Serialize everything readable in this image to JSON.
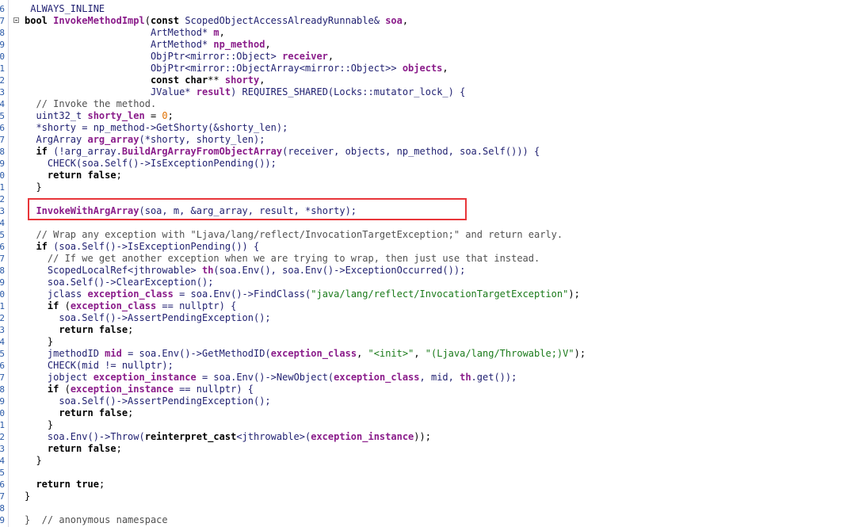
{
  "editor": {
    "lines": [
      {
        "ln": "6",
        "tokens": [
          {
            "t": " ALWAYS_INLINE",
            "c": "mac"
          }
        ]
      },
      {
        "ln": "7",
        "fold": true,
        "tokens": [
          {
            "t": "bool ",
            "c": "kw"
          },
          {
            "t": "InvokeMethodImpl",
            "c": "fn"
          },
          {
            "t": "(",
            "c": "op"
          },
          {
            "t": "const ",
            "c": "kw"
          },
          {
            "t": "ScopedObjectAccessAlreadyRunnable& ",
            "c": "id"
          },
          {
            "t": "soa",
            "c": "var"
          },
          {
            "t": ",",
            "c": "op"
          }
        ]
      },
      {
        "ln": "8",
        "tokens": [
          {
            "t": "                      ArtMethod* ",
            "c": "id"
          },
          {
            "t": "m",
            "c": "var"
          },
          {
            "t": ",",
            "c": "op"
          }
        ]
      },
      {
        "ln": "9",
        "tokens": [
          {
            "t": "                      ArtMethod* ",
            "c": "id"
          },
          {
            "t": "np_method",
            "c": "var"
          },
          {
            "t": ",",
            "c": "op"
          }
        ]
      },
      {
        "ln": "0",
        "tokens": [
          {
            "t": "                      ObjPtr<mirror::Object> ",
            "c": "id"
          },
          {
            "t": "receiver",
            "c": "var"
          },
          {
            "t": ",",
            "c": "op"
          }
        ]
      },
      {
        "ln": "1",
        "tokens": [
          {
            "t": "                      ObjPtr<mirror::ObjectArray<mirror::Object>> ",
            "c": "id"
          },
          {
            "t": "objects",
            "c": "var"
          },
          {
            "t": ",",
            "c": "op"
          }
        ]
      },
      {
        "ln": "2",
        "tokens": [
          {
            "t": "                      ",
            "c": "id"
          },
          {
            "t": "const char",
            "c": "kw"
          },
          {
            "t": "** ",
            "c": "op"
          },
          {
            "t": "shorty",
            "c": "var"
          },
          {
            "t": ",",
            "c": "op"
          }
        ]
      },
      {
        "ln": "3",
        "tokens": [
          {
            "t": "                      JValue* ",
            "c": "id"
          },
          {
            "t": "result",
            "c": "var"
          },
          {
            "t": ") REQUIRES_SHARED(Locks::mutator_lock_) {",
            "c": "id"
          }
        ]
      },
      {
        "ln": "4",
        "tokens": [
          {
            "t": "  // Invoke the method.",
            "c": "cm"
          }
        ]
      },
      {
        "ln": "5",
        "tokens": [
          {
            "t": "  uint32_t ",
            "c": "id"
          },
          {
            "t": "shorty_len",
            "c": "var"
          },
          {
            "t": " = ",
            "c": "op"
          },
          {
            "t": "0",
            "c": "num"
          },
          {
            "t": ";",
            "c": "op"
          }
        ]
      },
      {
        "ln": "6",
        "tokens": [
          {
            "t": "  *shorty = np_method->GetShorty(&shorty_len);",
            "c": "id"
          }
        ]
      },
      {
        "ln": "7",
        "tokens": [
          {
            "t": "  ArgArray ",
            "c": "id"
          },
          {
            "t": "arg_array",
            "c": "var"
          },
          {
            "t": "(*shorty, shorty_len);",
            "c": "id"
          }
        ]
      },
      {
        "ln": "8",
        "tokens": [
          {
            "t": "  ",
            "c": "id"
          },
          {
            "t": "if",
            "c": "kw"
          },
          {
            "t": " (!arg_array.",
            "c": "id"
          },
          {
            "t": "BuildArgArrayFromObjectArray",
            "c": "fn"
          },
          {
            "t": "(receiver, objects, np_method, soa.Self())) {",
            "c": "id"
          }
        ]
      },
      {
        "ln": "9",
        "tokens": [
          {
            "t": "    CHECK(soa.Self()->IsExceptionPending());",
            "c": "id"
          }
        ]
      },
      {
        "ln": "0",
        "tokens": [
          {
            "t": "    ",
            "c": "id"
          },
          {
            "t": "return false",
            "c": "kw"
          },
          {
            "t": ";",
            "c": "op"
          }
        ]
      },
      {
        "ln": "1",
        "tokens": [
          {
            "t": "  }",
            "c": "op"
          }
        ]
      },
      {
        "ln": "2",
        "tokens": []
      },
      {
        "ln": "3",
        "tokens": [
          {
            "t": "  ",
            "c": "id"
          },
          {
            "t": "InvokeWithArgArray",
            "c": "fn"
          },
          {
            "t": "(soa, m, &arg_array, result, *shorty);",
            "c": "id"
          }
        ]
      },
      {
        "ln": "4",
        "tokens": []
      },
      {
        "ln": "5",
        "tokens": [
          {
            "t": "  // Wrap any exception with \"Ljava/lang/reflect/InvocationTargetException;\" and return early.",
            "c": "cm"
          }
        ]
      },
      {
        "ln": "6",
        "tokens": [
          {
            "t": "  ",
            "c": "id"
          },
          {
            "t": "if",
            "c": "kw"
          },
          {
            "t": " (soa.Self()->IsExceptionPending()) {",
            "c": "id"
          }
        ]
      },
      {
        "ln": "7",
        "tokens": [
          {
            "t": "    // If we get another exception when we are trying to wrap, then just use that instead.",
            "c": "cm"
          }
        ]
      },
      {
        "ln": "8",
        "tokens": [
          {
            "t": "    ScopedLocalRef<jthrowable> ",
            "c": "id"
          },
          {
            "t": "th",
            "c": "var"
          },
          {
            "t": "(soa.Env(), soa.Env()->ExceptionOccurred());",
            "c": "id"
          }
        ]
      },
      {
        "ln": "9",
        "tokens": [
          {
            "t": "    soa.Self()->ClearException();",
            "c": "id"
          }
        ]
      },
      {
        "ln": "0",
        "tokens": [
          {
            "t": "    jclass ",
            "c": "id"
          },
          {
            "t": "exception_class",
            "c": "var"
          },
          {
            "t": " = soa.Env()->FindClass(",
            "c": "id"
          },
          {
            "t": "\"java/lang/reflect/InvocationTargetException\"",
            "c": "str"
          },
          {
            "t": ");",
            "c": "op"
          }
        ]
      },
      {
        "ln": "1",
        "tokens": [
          {
            "t": "    ",
            "c": "id"
          },
          {
            "t": "if",
            "c": "kw"
          },
          {
            "t": " (",
            "c": "op"
          },
          {
            "t": "exception_class",
            "c": "var"
          },
          {
            "t": " == nullptr) {",
            "c": "id"
          }
        ]
      },
      {
        "ln": "2",
        "tokens": [
          {
            "t": "      soa.Self()->AssertPendingException();",
            "c": "id"
          }
        ]
      },
      {
        "ln": "3",
        "tokens": [
          {
            "t": "      ",
            "c": "id"
          },
          {
            "t": "return false",
            "c": "kw"
          },
          {
            "t": ";",
            "c": "op"
          }
        ]
      },
      {
        "ln": "4",
        "tokens": [
          {
            "t": "    }",
            "c": "op"
          }
        ]
      },
      {
        "ln": "5",
        "tokens": [
          {
            "t": "    jmethodID ",
            "c": "id"
          },
          {
            "t": "mid",
            "c": "var"
          },
          {
            "t": " = soa.Env()->GetMethodID(",
            "c": "id"
          },
          {
            "t": "exception_class",
            "c": "var"
          },
          {
            "t": ", ",
            "c": "op"
          },
          {
            "t": "\"<init>\"",
            "c": "str"
          },
          {
            "t": ", ",
            "c": "op"
          },
          {
            "t": "\"(Ljava/lang/Throwable;)V\"",
            "c": "str"
          },
          {
            "t": ");",
            "c": "op"
          }
        ]
      },
      {
        "ln": "6",
        "tokens": [
          {
            "t": "    CHECK(mid != nullptr);",
            "c": "id"
          }
        ]
      },
      {
        "ln": "7",
        "tokens": [
          {
            "t": "    jobject ",
            "c": "id"
          },
          {
            "t": "exception_instance",
            "c": "var"
          },
          {
            "t": " = soa.Env()->NewObject(",
            "c": "id"
          },
          {
            "t": "exception_class",
            "c": "var"
          },
          {
            "t": ", mid, ",
            "c": "id"
          },
          {
            "t": "th",
            "c": "var"
          },
          {
            "t": ".get());",
            "c": "id"
          }
        ]
      },
      {
        "ln": "8",
        "tokens": [
          {
            "t": "    ",
            "c": "id"
          },
          {
            "t": "if",
            "c": "kw"
          },
          {
            "t": " (",
            "c": "op"
          },
          {
            "t": "exception_instance",
            "c": "var"
          },
          {
            "t": " == nullptr) {",
            "c": "id"
          }
        ]
      },
      {
        "ln": "9",
        "tokens": [
          {
            "t": "      soa.Self()->AssertPendingException();",
            "c": "id"
          }
        ]
      },
      {
        "ln": "0",
        "tokens": [
          {
            "t": "      ",
            "c": "id"
          },
          {
            "t": "return false",
            "c": "kw"
          },
          {
            "t": ";",
            "c": "op"
          }
        ]
      },
      {
        "ln": "1",
        "tokens": [
          {
            "t": "    }",
            "c": "op"
          }
        ]
      },
      {
        "ln": "2",
        "tokens": [
          {
            "t": "    soa.Env()->Throw(",
            "c": "id"
          },
          {
            "t": "reinterpret_cast",
            "c": "kw"
          },
          {
            "t": "<jthrowable>(",
            "c": "id"
          },
          {
            "t": "exception_instance",
            "c": "var"
          },
          {
            "t": "));",
            "c": "op"
          }
        ]
      },
      {
        "ln": "3",
        "tokens": [
          {
            "t": "    ",
            "c": "id"
          },
          {
            "t": "return false",
            "c": "kw"
          },
          {
            "t": ";",
            "c": "op"
          }
        ]
      },
      {
        "ln": "4",
        "tokens": [
          {
            "t": "  }",
            "c": "op"
          }
        ]
      },
      {
        "ln": "5",
        "tokens": []
      },
      {
        "ln": "6",
        "tokens": [
          {
            "t": "  ",
            "c": "id"
          },
          {
            "t": "return true",
            "c": "kw"
          },
          {
            "t": ";",
            "c": "op"
          }
        ]
      },
      {
        "ln": "7",
        "tokens": [
          {
            "t": "}",
            "c": "op"
          }
        ]
      },
      {
        "ln": "8",
        "tokens": []
      },
      {
        "ln": "9",
        "tokens": [
          {
            "t": "}  // anonymous namespace",
            "c": "cm"
          }
        ]
      }
    ],
    "highlight_color": "#e8363a"
  }
}
